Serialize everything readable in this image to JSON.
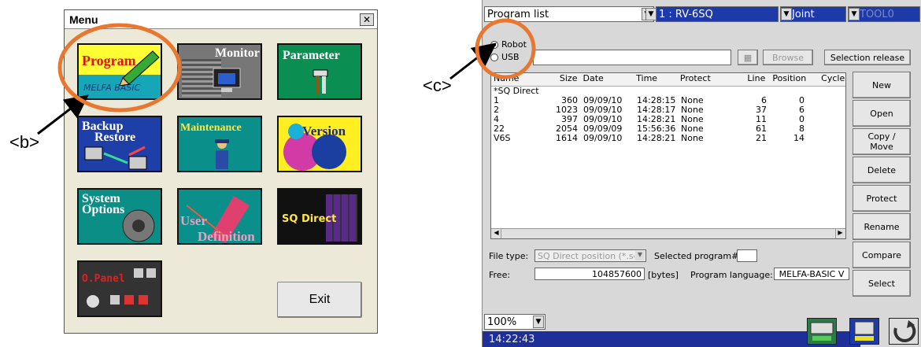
{
  "annotations": {
    "b": "<b>",
    "c": "<c>"
  },
  "menu": {
    "title": "Menu",
    "close_label": "✕",
    "tiles": {
      "program": {
        "label": "Program",
        "sublabel": "MELFA BASIC"
      },
      "monitor": {
        "label": "Monitor"
      },
      "parameter": {
        "label": "Parameter"
      },
      "backup": {
        "label1": "Backup",
        "label2": "Restore"
      },
      "maintenance": {
        "label": "Maintenance"
      },
      "version": {
        "label": "Version"
      },
      "system": {
        "label1": "System",
        "label2": "Options"
      },
      "user": {
        "label1": "User",
        "label2": "Definition"
      },
      "sqdirect": {
        "label": "SQ Direct"
      },
      "opanel": {
        "label": "O.Panel"
      }
    },
    "exit_label": "Exit"
  },
  "program_window": {
    "title_combo": "Program list",
    "robot_combo": "1 : RV-6SQ",
    "joint_combo": "Joint",
    "tool_combo": "TOOL0",
    "radio_robot": "Robot",
    "radio_usb": "USB",
    "browse_label": "Browse",
    "selection_release_label": "Selection release",
    "columns": [
      "Name",
      "Size",
      "Date",
      "Time",
      "Protect",
      "Line",
      "Position",
      "Cycle"
    ],
    "rows": [
      {
        "name": "*SQ Direct",
        "size": "",
        "date": "",
        "time": "",
        "protect": "",
        "line": "",
        "position": ""
      },
      {
        "name": "1",
        "size": "360",
        "date": "09/09/10",
        "time": "14:28:15",
        "protect": "None",
        "line": "6",
        "position": "0"
      },
      {
        "name": "2",
        "size": "1023",
        "date": "09/09/10",
        "time": "14:28:17",
        "protect": "None",
        "line": "37",
        "position": "6"
      },
      {
        "name": "4",
        "size": "397",
        "date": "09/09/10",
        "time": "14:28:21",
        "protect": "None",
        "line": "11",
        "position": "0"
      },
      {
        "name": "22",
        "size": "2054",
        "date": "09/09/09",
        "time": "15:56:36",
        "protect": "None",
        "line": "61",
        "position": "8"
      },
      {
        "name": "V6S",
        "size": "1614",
        "date": "09/09/10",
        "time": "14:28:21",
        "protect": "None",
        "line": "21",
        "position": "14"
      }
    ],
    "side_buttons": {
      "new": "New",
      "open": "Open",
      "copy": "Copy /\nMove",
      "delete": "Delete",
      "protect": "Protect",
      "rename": "Rename",
      "compare": "Compare",
      "select": "Select"
    },
    "file_type_label": "File type:",
    "file_type_value": "SQ Direct position (*.sdp",
    "selected_label": "Selected program#:",
    "free_label": "Free:",
    "free_value": "104857600",
    "free_unit": "[bytes]",
    "language_label": "Program language:",
    "language_value": "MELFA-BASIC V",
    "zoom": "100%",
    "clock": "14:22:43"
  }
}
